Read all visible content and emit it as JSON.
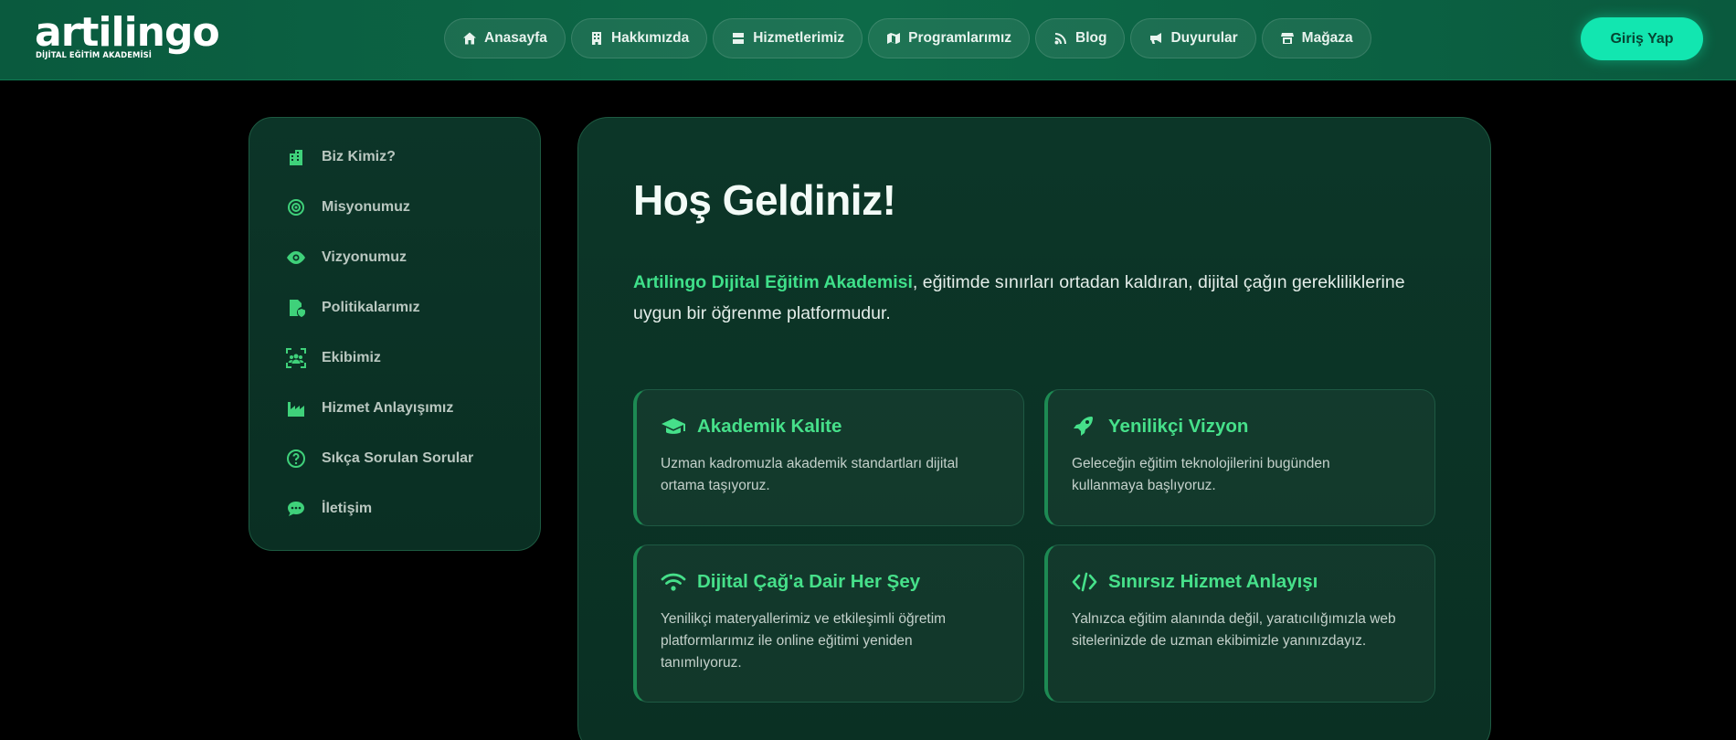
{
  "header": {
    "logo": {
      "word": "artilingo",
      "subtitle": "DİJİTAL EĞİTİM AKADEMİSİ"
    },
    "nav": [
      {
        "label": "Anasayfa",
        "icon": "home-icon"
      },
      {
        "label": "Hakkımızda",
        "icon": "building-icon"
      },
      {
        "label": "Hizmetlerimiz",
        "icon": "server-icon"
      },
      {
        "label": "Programlarımız",
        "icon": "map-icon"
      },
      {
        "label": "Blog",
        "icon": "rss-icon"
      },
      {
        "label": "Duyurular",
        "icon": "megaphone-icon"
      },
      {
        "label": "Mağaza",
        "icon": "store-icon"
      }
    ],
    "login_label": "Giriş Yap"
  },
  "sidebar": {
    "items": [
      {
        "label": "Biz Kimiz?",
        "icon": "buildings-icon"
      },
      {
        "label": "Misyonumuz",
        "icon": "target-icon"
      },
      {
        "label": "Vizyonumuz",
        "icon": "eye-icon"
      },
      {
        "label": "Politikalarımız",
        "icon": "file-shield-icon"
      },
      {
        "label": "Ekibimiz",
        "icon": "team-icon"
      },
      {
        "label": "Hizmet Anlayışımız",
        "icon": "industry-icon"
      },
      {
        "label": "Sıkça Sorulan Sorular",
        "icon": "question-circle-icon"
      },
      {
        "label": "İletişim",
        "icon": "chat-icon"
      }
    ]
  },
  "main": {
    "title": "Hoş Geldiniz!",
    "intro_brand": "Artilingo Dijital Eğitim Akademisi",
    "intro_text": ", eğitimde sınırları ortadan kaldıran, dijital çağın gerekliliklerine uygun bir öğrenme platformudur.",
    "features": [
      {
        "title": "Akademik Kalite",
        "icon": "graduation-cap-icon",
        "desc": "Uzman kadromuzla akademik standartları dijital ortama taşıyoruz."
      },
      {
        "title": "Yenilikçi Vizyon",
        "icon": "rocket-icon",
        "desc": "Geleceğin eğitim teknolojilerini bugünden kullanmaya başlıyoruz."
      },
      {
        "title": "Dijital Çağ'a Dair Her Şey",
        "icon": "wifi-icon",
        "desc": "Yenilikçi materyallerimiz ve etkileşimli öğretim platformlarımız ile online eğitimi yeniden tanımlıyoruz."
      },
      {
        "title": "Sınırsız Hizmet Anlayışı",
        "icon": "code-icon",
        "desc": "Yalnızca eğitim alanında değil, yaratıcılığımızla web sitelerinizde de uzman ekibimizle yanınızdayız."
      }
    ]
  },
  "colors": {
    "accent": "#12e6b0",
    "brand_green": "#3fe08a",
    "header_bg": "#0a5a3e"
  }
}
